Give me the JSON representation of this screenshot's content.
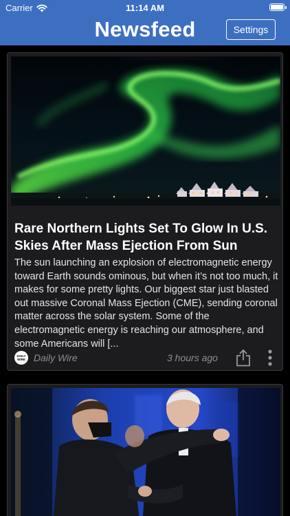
{
  "status_bar": {
    "carrier": "Carrier",
    "time": "11:14 AM",
    "wifi_icon": "wifi-icon",
    "battery_icon": "battery-full-icon"
  },
  "nav": {
    "title": "Newsfeed",
    "settings_label": "Settings",
    "background_color": "#3d6fc1"
  },
  "articles": [
    {
      "image": "northern-lights-photo",
      "title": "Rare Northern Lights Set To Glow In U.S. Skies After Mass Ejection From Sun",
      "summary": "The sun launching an explosion of electromagnetic energy toward Earth sounds ominous, but when it’s not too much, it makes for some pretty lights. Our biggest star just blasted out massive Coronal Mass Ejection (CME), sending coronal matter across the solar system. Some of the electromagnetic energy is reaching our atmosphere, and some Americans will [...",
      "source": "Daily Wire",
      "source_logo_text": "DAILY WIRE",
      "timestamp": "3 hours ago",
      "share_icon": "share-icon",
      "more_icon": "more-vertical-icon"
    },
    {
      "image": "two-men-embracing-photo"
    }
  ]
}
